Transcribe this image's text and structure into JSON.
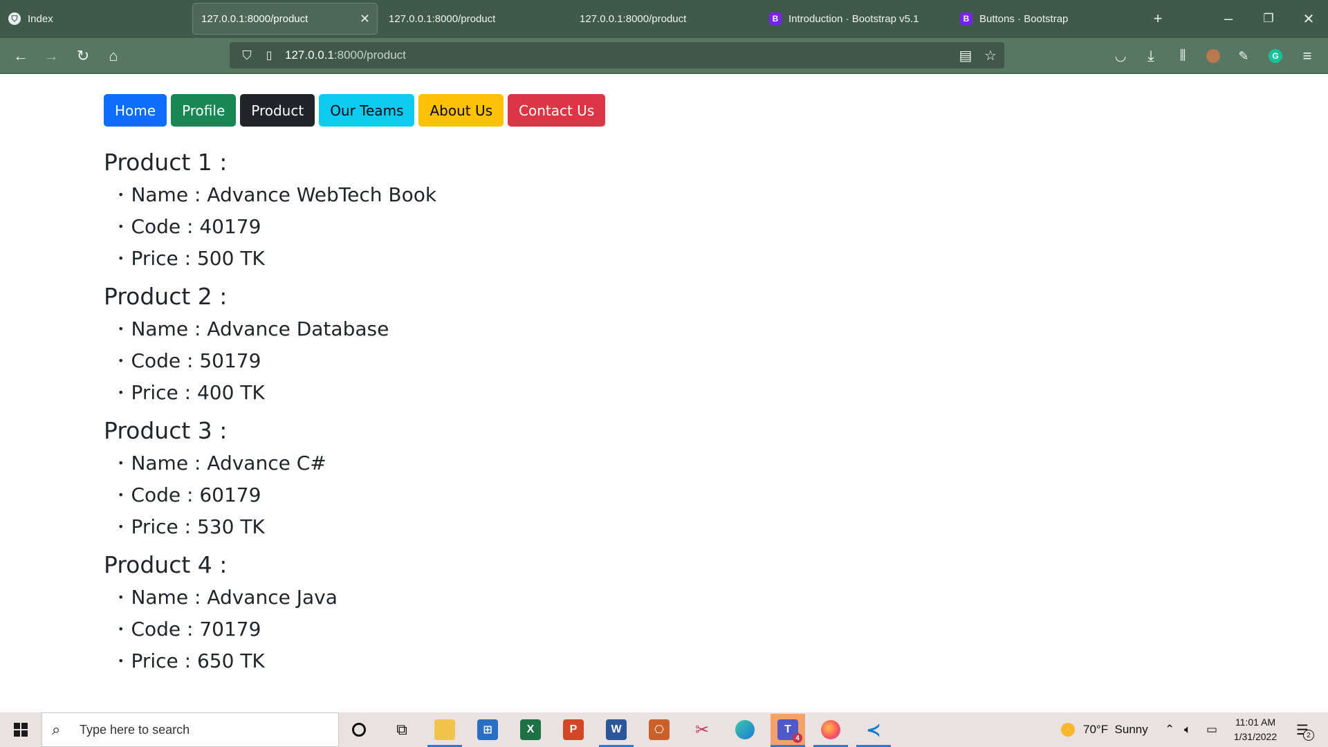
{
  "browser": {
    "tabs": [
      {
        "label": "Index",
        "icon": "shield-icon"
      },
      {
        "label": "127.0.0.1:8000/product",
        "icon": "",
        "active": true
      },
      {
        "label": "127.0.0.1:8000/product",
        "icon": ""
      },
      {
        "label": "127.0.0.1:8000/product",
        "icon": ""
      },
      {
        "label": "Introduction · Bootstrap v5.1",
        "icon": "bootstrap-icon"
      },
      {
        "label": "Buttons · Bootstrap",
        "icon": "bootstrap-icon"
      }
    ],
    "url_host": "127.0.0.1",
    "url_rest": ":8000/product",
    "favicon_letter": "B"
  },
  "menu": [
    {
      "label": "Home",
      "style": "primary",
      "color": "#0d6efd"
    },
    {
      "label": "Profile",
      "style": "success",
      "color": "#198754"
    },
    {
      "label": "Product",
      "style": "dark",
      "color": "#212529"
    },
    {
      "label": "Our Teams",
      "style": "info",
      "color": "#0dcaf0"
    },
    {
      "label": "About Us",
      "style": "warning",
      "color": "#ffc107"
    },
    {
      "label": "Contact Us",
      "style": "danger",
      "color": "#dc3545"
    }
  ],
  "products": [
    {
      "heading": "Product 1 :",
      "name": "Name : Advance WebTech Book",
      "code": "Code : 40179",
      "price": "Price : 500 TK"
    },
    {
      "heading": "Product 2 :",
      "name": "Name : Advance Database",
      "code": "Code : 50179",
      "price": "Price : 400 TK"
    },
    {
      "heading": "Product 3 :",
      "name": "Name : Advance C#",
      "code": "Code : 60179",
      "price": "Price : 530 TK"
    },
    {
      "heading": "Product 4 :",
      "name": "Name : Advance Java",
      "code": "Code : 70179",
      "price": "Price : 650 TK"
    }
  ],
  "taskbar": {
    "search_placeholder": "Type here to search",
    "weather": "70°F  Sunny",
    "time": "11:01 AM",
    "date": "1/31/2022",
    "notification_count": "2",
    "teams_badge": "4"
  },
  "bullet": "•"
}
